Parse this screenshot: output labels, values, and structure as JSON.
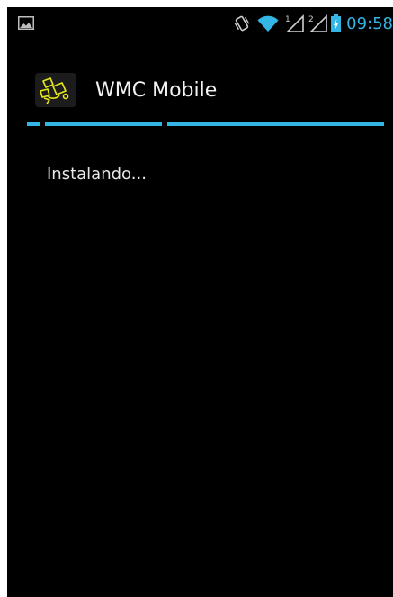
{
  "status_bar": {
    "time": "09:58",
    "left_icon": "gallery-icon",
    "right_icons": [
      "vibrate-icon",
      "wifi-icon",
      "sim1-signal-icon",
      "sim2-signal-icon",
      "battery-charging-icon"
    ],
    "sim1_label": "1",
    "sim2_label": "2",
    "accent_color": "#33b5e5"
  },
  "action_bar": {
    "title": "WMC Mobile",
    "app_icon": "wmc-app-icon"
  },
  "content": {
    "message": "Instalando..."
  },
  "colors": {
    "background": "#000000",
    "accent": "#33b5e5",
    "text": "#f2f2f2"
  }
}
